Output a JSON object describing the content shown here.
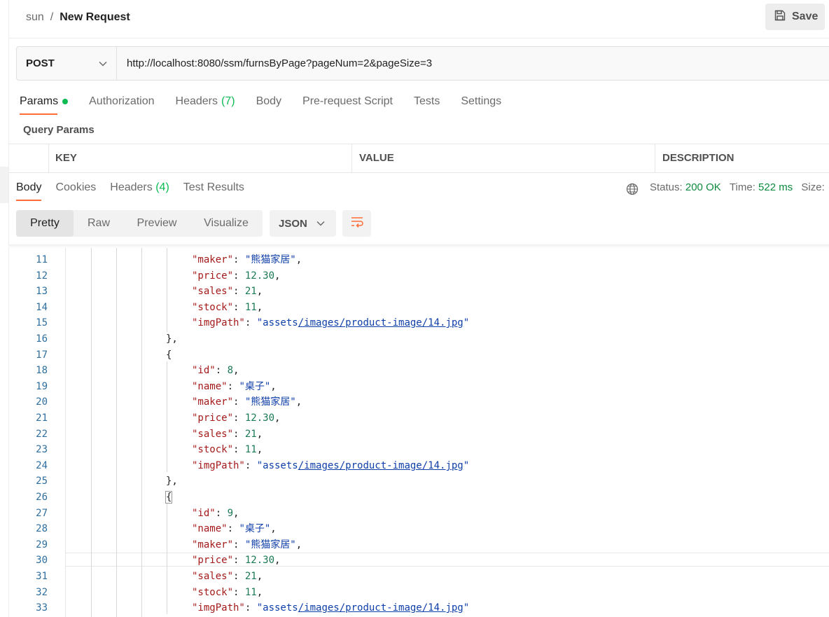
{
  "header": {
    "workspace": "sun",
    "separator": "/",
    "title": "New Request",
    "save_label": "Save"
  },
  "request": {
    "method": "POST",
    "url": "http://localhost:8080/ssm/furnsByPage?pageNum=2&pageSize=3"
  },
  "request_tabs": {
    "params": "Params",
    "authorization": "Authorization",
    "headers": "Headers",
    "headers_count": "(7)",
    "body": "Body",
    "prerequest": "Pre-request Script",
    "tests": "Tests",
    "settings": "Settings"
  },
  "query_params": {
    "title": "Query Params",
    "columns": {
      "key": "KEY",
      "value": "VALUE",
      "description": "DESCRIPTION"
    }
  },
  "response_tabs": {
    "body": "Body",
    "cookies": "Cookies",
    "headers": "Headers",
    "headers_count": "(4)",
    "test_results": "Test Results"
  },
  "status": {
    "status_label": "Status:",
    "status_value": "200 OK",
    "time_label": "Time:",
    "time_value": "522 ms",
    "size_label": "Size:"
  },
  "view": {
    "pretty": "Pretty",
    "raw": "Raw",
    "preview": "Preview",
    "visualize": "Visualize",
    "format": "JSON"
  },
  "code_lines": [
    {
      "n": "11",
      "key": "\"maker\"",
      "str": "\"熊猫家居\"",
      "tail": ","
    },
    {
      "n": "12",
      "key": "\"price\"",
      "num": "12.30",
      "tail": ","
    },
    {
      "n": "13",
      "key": "\"sales\"",
      "num": "21",
      "tail": ","
    },
    {
      "n": "14",
      "key": "\"stock\"",
      "num": "11",
      "tail": ","
    },
    {
      "n": "15",
      "key": "\"imgPath\"",
      "str": "\"assets/images/product-image/14.jpg\""
    },
    {
      "n": "16",
      "punct": "},"
    },
    {
      "n": "17",
      "punct": "{"
    },
    {
      "n": "18",
      "key": "\"id\"",
      "num": "8",
      "tail": ","
    },
    {
      "n": "19",
      "key": "\"name\"",
      "str": "\"桌子\"",
      "tail": ","
    },
    {
      "n": "20",
      "key": "\"maker\"",
      "str": "\"熊猫家居\"",
      "tail": ","
    },
    {
      "n": "21",
      "key": "\"price\"",
      "num": "12.30",
      "tail": ","
    },
    {
      "n": "22",
      "key": "\"sales\"",
      "num": "21",
      "tail": ","
    },
    {
      "n": "23",
      "key": "\"stock\"",
      "num": "11",
      "tail": ","
    },
    {
      "n": "24",
      "key": "\"imgPath\"",
      "str": "\"assets/images/product-image/14.jpg\""
    },
    {
      "n": "25",
      "punct": "},"
    },
    {
      "n": "26",
      "punct": "{",
      "boxed": true
    },
    {
      "n": "27",
      "key": "\"id\"",
      "num": "9",
      "tail": ","
    },
    {
      "n": "28",
      "key": "\"name\"",
      "str": "\"桌子\"",
      "tail": ","
    },
    {
      "n": "29",
      "key": "\"maker\"",
      "str": "\"熊猫家居\"",
      "tail": ","
    },
    {
      "n": "30",
      "key": "\"price\"",
      "num": "12.30",
      "tail": ","
    },
    {
      "n": "31",
      "key": "\"sales\"",
      "num": "21",
      "tail": ","
    },
    {
      "n": "32",
      "key": "\"stock\"",
      "num": "11",
      "tail": ","
    },
    {
      "n": "33",
      "key": "\"imgPath\"",
      "str": "\"assets/images/product-image/14.jpg\""
    }
  ]
}
